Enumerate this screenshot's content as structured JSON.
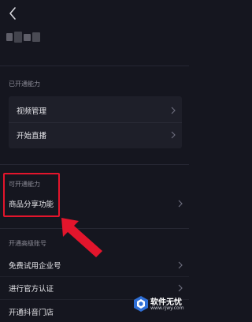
{
  "header": {
    "back_icon": "chevron-left-icon"
  },
  "profile": {
    "name_blurred": true
  },
  "opened": {
    "title": "已开通能力",
    "items": [
      {
        "label": "视频管理",
        "icon": "chevron-right-icon"
      },
      {
        "label": "开始直播",
        "icon": "chevron-right-icon"
      }
    ]
  },
  "available": {
    "title": "可开通能力",
    "items": [
      {
        "label": "商品分享功能",
        "icon": "chevron-right-icon"
      }
    ]
  },
  "advanced": {
    "title": "开通高级账号",
    "items": [
      {
        "label": "免费试用企业号",
        "icon": "chevron-right-icon"
      },
      {
        "label": "进行官方认证",
        "icon": "chevron-right-icon"
      },
      {
        "label": "开通抖音门店",
        "icon": "chevron-right-icon"
      }
    ]
  },
  "annotation": {
    "highlight_color": "#e3152c"
  },
  "watermark": {
    "title": "软件无忧",
    "subtitle": "www.rjwy.com"
  },
  "colors": {
    "background": "#15161f",
    "card": "#1e1f29",
    "text": "#e6e6ea",
    "muted": "#8a8a95"
  }
}
